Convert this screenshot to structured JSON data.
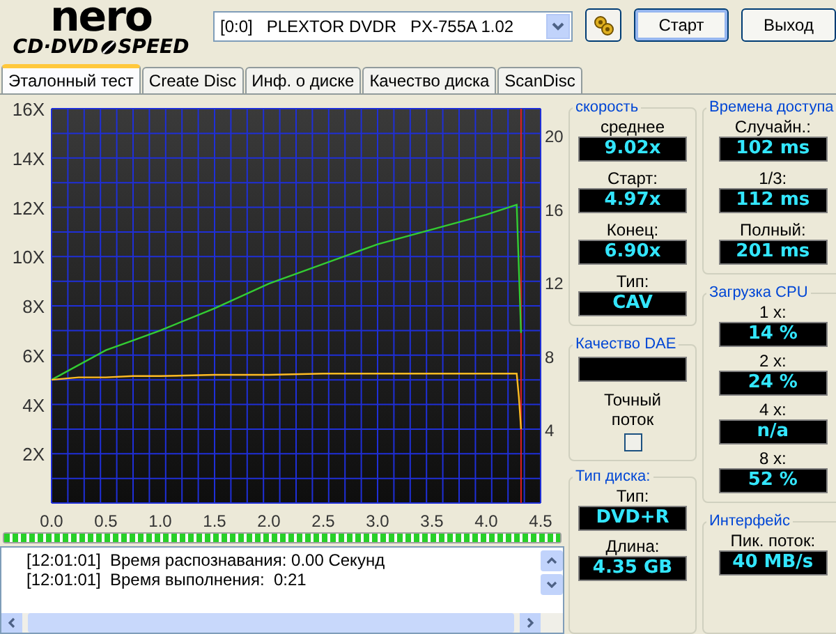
{
  "header": {
    "logo_word": "nero",
    "logo_left": "CD·DVD",
    "logo_right": "SPEED",
    "drive": "[0:0]   PLEXTOR DVDR   PX-755A 1.02",
    "buttons": [
      {
        "label": "Старт",
        "default": true
      },
      {
        "label": "Выход",
        "default": false
      }
    ]
  },
  "tabs": [
    {
      "label": "Эталонный тест",
      "selected": true
    },
    {
      "label": "Create Disc",
      "selected": false
    },
    {
      "label": "Инф. о диске",
      "selected": false
    },
    {
      "label": "Качество диска",
      "selected": false
    },
    {
      "label": "ScanDisc",
      "selected": false
    }
  ],
  "chart": {
    "right_yticks": [
      "20",
      "16",
      "12",
      "8",
      "4"
    ],
    "chart_data": {
      "type": "line",
      "grid": true,
      "ref_lines": [
        {
          "axis": "x",
          "value": 4.32,
          "color": "#e02020"
        }
      ],
      "x": [
        0,
        0.25,
        0.5,
        0.75,
        1.0,
        1.5,
        2.0,
        2.5,
        3.0,
        3.5,
        4.0,
        4.28,
        4.3,
        4.32
      ],
      "xlim": [
        0,
        4.5
      ],
      "ylim": [
        0,
        16
      ],
      "xticks": [
        {
          "value": 0,
          "label": "0.0"
        },
        {
          "value": 0.5,
          "label": "0.5"
        },
        {
          "value": 1,
          "label": "1.0"
        },
        {
          "value": 1.5,
          "label": "1.5"
        },
        {
          "value": 2,
          "label": "2.0"
        },
        {
          "value": 2.5,
          "label": "2.5"
        },
        {
          "value": 3,
          "label": "3.0"
        },
        {
          "value": 3.5,
          "label": "3.5"
        },
        {
          "value": 4,
          "label": "4.0"
        },
        {
          "value": 4.5,
          "label": "4.5"
        }
      ],
      "yticks": [
        {
          "value": 2,
          "label": "2X"
        },
        {
          "value": 4,
          "label": "4X"
        },
        {
          "value": 6,
          "label": "6X"
        },
        {
          "value": 8,
          "label": "8X"
        },
        {
          "value": 10,
          "label": "10X"
        },
        {
          "value": 12,
          "label": "12X"
        },
        {
          "value": 14,
          "label": "14X"
        },
        {
          "value": 16,
          "label": "16X"
        }
      ],
      "series": [
        {
          "color": "#33cc33",
          "values": [
            5.0,
            5.6,
            6.2,
            6.6,
            7.0,
            7.9,
            8.9,
            9.7,
            10.5,
            11.1,
            11.7,
            12.1,
            9.5,
            6.9
          ]
        },
        {
          "color": "#ffbb22",
          "values": [
            5.0,
            5.1,
            5.1,
            5.15,
            5.15,
            5.2,
            5.2,
            5.25,
            5.25,
            5.25,
            5.25,
            5.25,
            4.3,
            3.0
          ]
        }
      ]
    }
  },
  "progress": {
    "level": 1
  },
  "log": [
    {
      "time": "[12:01:01]",
      "text": "Время распознавания: 0.00 Секунд"
    },
    {
      "time": "[12:01:01]",
      "text": "Время выполнения:  0:21"
    }
  ],
  "panels": {
    "speed": {
      "title": "скорость",
      "items": [
        {
          "label": "среднее",
          "value": "9.02x"
        },
        {
          "label": "Старт:",
          "value": "4.97x"
        },
        {
          "label": "Конец:",
          "value": "6.90x"
        },
        {
          "label": "Тип:",
          "value": "CAV"
        }
      ]
    },
    "dae": {
      "title": "Качество DAE",
      "label": "Точный поток",
      "checked": false
    },
    "disc": {
      "title": "Тип диска:",
      "items": [
        {
          "label": "Тип:",
          "value": "DVD+R"
        },
        {
          "label": "Длина:",
          "value": "4.35 GB"
        }
      ]
    },
    "access": {
      "title": "Времена доступа",
      "items": [
        {
          "label": "Случайн.:",
          "value": "102 ms"
        },
        {
          "label": "1/3:",
          "value": "112 ms"
        },
        {
          "label": "Полный:",
          "value": "201 ms"
        }
      ]
    },
    "cpu": {
      "title": "Загрузка CPU",
      "items": [
        {
          "label": "1 x:",
          "value": "14 %"
        },
        {
          "label": "2 x:",
          "value": "24 %"
        },
        {
          "label": "4 x:",
          "value": "n/a"
        },
        {
          "label": "8 x:",
          "value": "52 %"
        }
      ]
    },
    "interface": {
      "title": "Интерфейс",
      "items": [
        {
          "label": "Пик. поток:",
          "value": "40 MB/s"
        }
      ]
    }
  }
}
